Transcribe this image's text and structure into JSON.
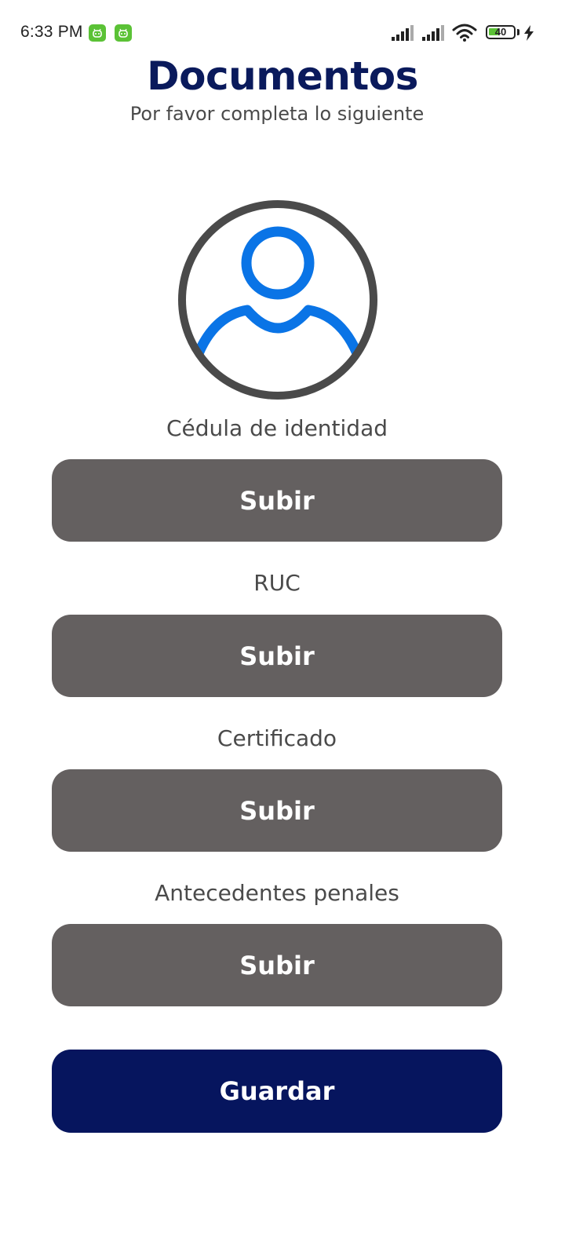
{
  "status_bar": {
    "time": "6:33 PM",
    "battery_level": "40",
    "notification_icons": [
      "android-robot-icon",
      "android-robot-icon"
    ],
    "system_icons": [
      "signal-icon",
      "signal-icon",
      "wifi-icon",
      "battery-icon",
      "charging-icon"
    ]
  },
  "header": {
    "title": "Documentos",
    "subtitle": "Por favor completa lo siguiente"
  },
  "avatar": {
    "icon": "user-avatar-icon",
    "ring_color": "#4a4a4a",
    "figure_color": "#0a74e6"
  },
  "documents": [
    {
      "label": "Cédula de identidad",
      "button_label": "Subir"
    },
    {
      "label": "RUC",
      "button_label": "Subir"
    },
    {
      "label": "Certificado",
      "button_label": "Subir"
    },
    {
      "label": "Antecedentes penales",
      "button_label": "Subir"
    }
  ],
  "actions": {
    "save_label": "Guardar"
  },
  "colors": {
    "title": "#0a1a5c",
    "upload_button": "#646060",
    "save_button": "#06155e"
  }
}
